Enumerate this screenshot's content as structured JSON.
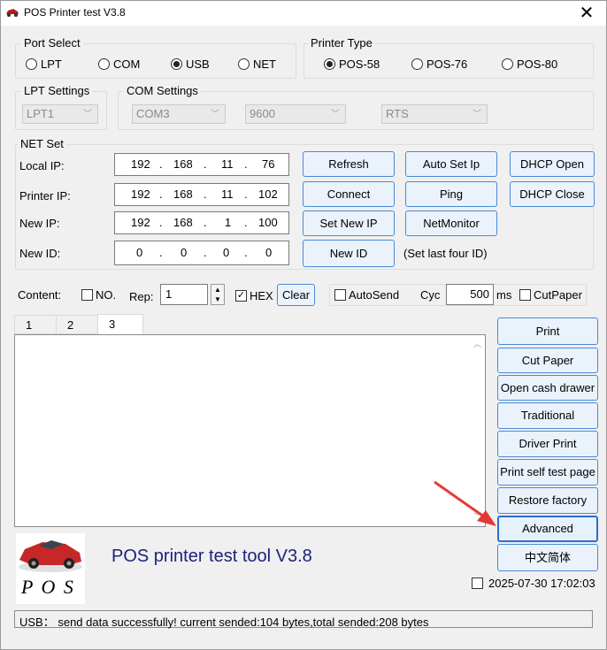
{
  "window": {
    "title": "POS Printer test V3.8",
    "close": "✕"
  },
  "port_select": {
    "label": "Port Select",
    "options": [
      "LPT",
      "COM",
      "USB",
      "NET"
    ],
    "selected": "USB"
  },
  "printer_type": {
    "label": "Printer Type",
    "options": [
      "POS-58",
      "POS-76",
      "POS-80"
    ],
    "selected": "POS-58"
  },
  "lpt_settings": {
    "label": "LPT Settings",
    "value": "LPT1"
  },
  "com_settings": {
    "label": "COM Settings",
    "port": "COM3",
    "baud": "9600",
    "flow": "RTS"
  },
  "net_set": {
    "label": "NET Set",
    "local_ip": {
      "label": "Local IP:",
      "octets": [
        "192",
        "168",
        "11",
        "76"
      ]
    },
    "printer_ip": {
      "label": "Printer IP:",
      "octets": [
        "192",
        "168",
        "11",
        "102"
      ]
    },
    "new_ip": {
      "label": "New IP:",
      "octets": [
        "192",
        "168",
        "1",
        "100"
      ]
    },
    "new_id": {
      "label": "New ID:",
      "octets": [
        "0",
        "0",
        "0",
        "0"
      ]
    },
    "dot": ".",
    "buttons": {
      "refresh": "Refresh",
      "auto_set_ip": "Auto Set Ip",
      "dhcp_open": "DHCP Open",
      "connect": "Connect",
      "ping": "Ping",
      "dhcp_close": "DHCP Close",
      "set_new_ip": "Set New IP",
      "net_monitor": "NetMonitor",
      "new_id": "New ID"
    },
    "note": "(Set last four ID)"
  },
  "content_row": {
    "content_label": "Content:",
    "no_label": "NO.",
    "rep_label": "Rep:",
    "rep_value": "1",
    "hex_label": "HEX",
    "hex_checked": "✓",
    "clear": "Clear",
    "autosend_label": "AutoSend",
    "cyc_label": "Cyc",
    "cyc_value": "500",
    "ms_label": "ms",
    "cutpaper_label": "CutPaper"
  },
  "tabs": [
    "1",
    "2",
    "3"
  ],
  "active_tab": "3",
  "side_buttons": [
    "Print",
    "Cut Paper",
    "Open cash drawer",
    "Traditional",
    "Driver Print",
    "Print self test page",
    "Restore factory",
    "Advanced",
    "中文简体"
  ],
  "logo_text": "P O S",
  "tool_title": "POS printer test tool V3.8",
  "datetime": "2025-07-30 17:02:03",
  "status": "USB： send data successfully! current sended:104 bytes,total sended:208 bytes",
  "colors": {
    "accent": "#2b6fd1",
    "title_text": "#1a237e",
    "arrow": "#e53935"
  }
}
